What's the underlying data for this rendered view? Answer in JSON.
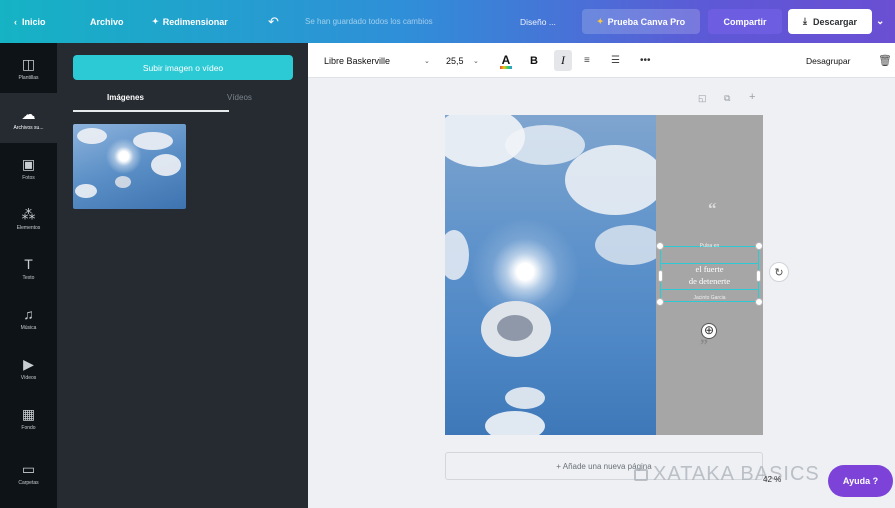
{
  "topbar": {
    "home_label": "Inicio",
    "home_icon": "chevron-left-icon",
    "file_label": "Archivo",
    "resize_label": "Redimensionar",
    "undo_icon": "undo-icon",
    "saved_status": "Se han guardado todos los cambios",
    "design_label": "Diseño ...",
    "pro_label": "Prueba Canva Pro",
    "share_label": "Compartir",
    "download_label": "Descargar",
    "download_icon": "download-icon",
    "more_icon": "chevron-down-icon"
  },
  "rail": {
    "items": [
      {
        "label": "Plantillas",
        "icon": "template-icon",
        "glyph": "◫"
      },
      {
        "label": "Archivos su...",
        "icon": "cloud-upload-icon",
        "glyph": "☁"
      },
      {
        "label": "Fotos",
        "icon": "photo-icon",
        "glyph": "▣"
      },
      {
        "label": "Elementos",
        "icon": "shapes-icon",
        "glyph": "⁂"
      },
      {
        "label": "Texto",
        "icon": "text-icon",
        "glyph": "T"
      },
      {
        "label": "Música",
        "icon": "music-icon",
        "glyph": "♫"
      },
      {
        "label": "Vídeos",
        "icon": "video-icon",
        "glyph": "▶"
      },
      {
        "label": "Fondo",
        "icon": "background-icon",
        "glyph": "▦"
      },
      {
        "label": "Carpetas",
        "icon": "folder-icon",
        "glyph": "▭"
      }
    ]
  },
  "panel": {
    "upload_label": "Subir imagen o vídeo",
    "tab_images": "Imágenes",
    "tab_videos": "Vídeos"
  },
  "toolbar": {
    "font_name": "Libre Baskerville",
    "font_size": "25,5",
    "color_label": "A",
    "bold_label": "B",
    "italic_label": "I",
    "ungroup_label": "Desagrupar"
  },
  "canvas": {
    "small_top": "Pulsa en",
    "main_text_line1": "el fuerte",
    "main_text_line2": "de detenerte",
    "small_bottom": "Jacinto Garcia"
  },
  "add_page_label": "+ Añade una nueva página",
  "zoom_label": "42 %",
  "watermark_text": "XATAKA BASICS",
  "help_label": "Ayuda ?",
  "colors": {
    "accent": "#2ccad5",
    "share": "#6d5de0",
    "help": "#7d43d9"
  }
}
